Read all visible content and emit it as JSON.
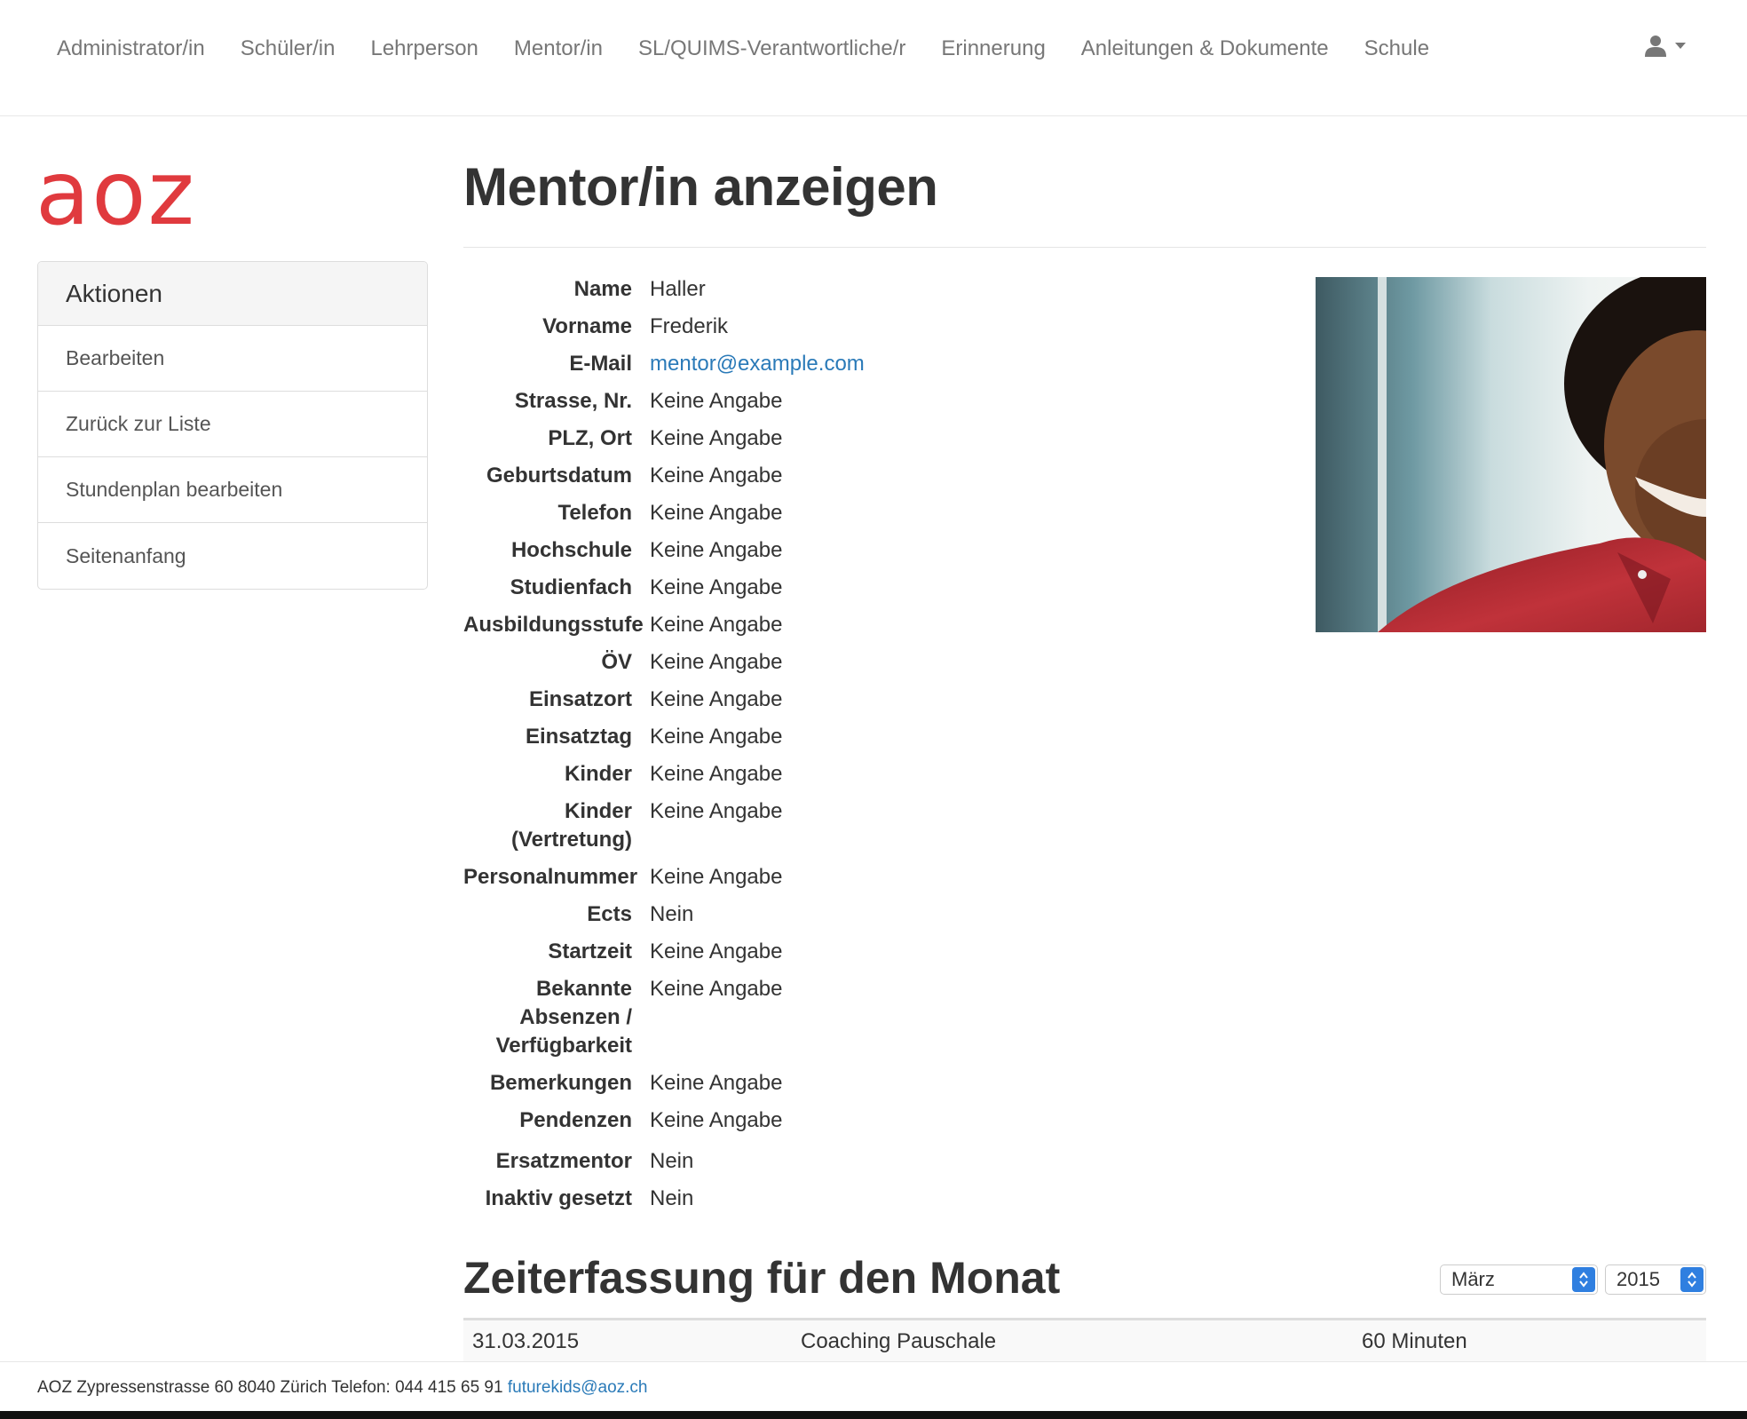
{
  "nav": {
    "items": [
      {
        "label": "Administrator/in"
      },
      {
        "label": "Schüler/in"
      },
      {
        "label": "Lehrperson"
      },
      {
        "label": "Mentor/in"
      },
      {
        "label": "SL/QUIMS-Verantwortliche/r"
      },
      {
        "label": "Erinnerung"
      },
      {
        "label": "Anleitungen & Dokumente"
      },
      {
        "label": "Schule"
      }
    ],
    "user_icon": "user-icon",
    "caret_icon": "caret-down-icon"
  },
  "logo": {
    "text": "aoz",
    "color": "#e03a3e"
  },
  "sidebar": {
    "heading": "Aktionen",
    "items": [
      {
        "label": "Bearbeiten"
      },
      {
        "label": "Zurück zur Liste"
      },
      {
        "label": "Stundenplan bearbeiten"
      },
      {
        "label": "Seitenanfang"
      }
    ]
  },
  "page": {
    "title": "Mentor/in anzeigen"
  },
  "details": {
    "name": {
      "label": "Name",
      "value": "Haller"
    },
    "vorname": {
      "label": "Vorname",
      "value": "Frederik"
    },
    "email": {
      "label": "E-Mail",
      "value": "mentor@example.com"
    },
    "strasse": {
      "label": "Strasse, Nr.",
      "value": "Keine Angabe"
    },
    "plz": {
      "label": "PLZ, Ort",
      "value": "Keine Angabe"
    },
    "geburtsdatum": {
      "label": "Geburtsdatum",
      "value": "Keine Angabe"
    },
    "telefon": {
      "label": "Telefon",
      "value": "Keine Angabe"
    },
    "hochschule": {
      "label": "Hochschule",
      "value": "Keine Angabe"
    },
    "studienfach": {
      "label": "Studienfach",
      "value": "Keine Angabe"
    },
    "ausbildungsstufe": {
      "label": "Ausbildungsstufe",
      "value": "Keine Angabe"
    },
    "oev": {
      "label": "ÖV",
      "value": "Keine Angabe"
    },
    "einsatzort": {
      "label": "Einsatzort",
      "value": "Keine Angabe"
    },
    "einsatztag": {
      "label": "Einsatztag",
      "value": "Keine Angabe"
    },
    "kinder": {
      "label": "Kinder",
      "value": "Keine Angabe"
    },
    "kinder_vertretung": {
      "label": "Kinder (Vertretung)",
      "value": "Keine Angabe"
    },
    "personalnummer": {
      "label": "Personalnummer",
      "value": "Keine Angabe"
    },
    "ects": {
      "label": "Ects",
      "value": "Nein"
    },
    "startzeit": {
      "label": "Startzeit",
      "value": "Keine Angabe"
    },
    "absenzen": {
      "label": "Bekannte Absenzen / Verfügbarkeit",
      "value": "Keine Angabe"
    },
    "bemerkungen": {
      "label": "Bemerkungen",
      "value": "Keine Angabe"
    },
    "pendenzen": {
      "label": "Pendenzen",
      "value": "Keine Angabe"
    },
    "ersatzmentor": {
      "label": "Ersatzmentor",
      "value": "Nein"
    },
    "inaktiv": {
      "label": "Inaktiv gesetzt",
      "value": "Nein"
    }
  },
  "zeiterfassung": {
    "title": "Zeiterfassung für den Monat",
    "month": "März",
    "year": "2015",
    "rows": [
      {
        "date": "31.03.2015",
        "type": "Coaching Pauschale",
        "duration": "60 Minuten"
      }
    ]
  },
  "footer": {
    "address": "AOZ Zypressenstrasse 60 8040 Zürich Telefon: 044 415 65 91",
    "email": "futurekids@aoz.ch"
  },
  "colors": {
    "link": "#2a7ab8",
    "brand": "#e03a3e",
    "select_accent": "#2f7fe0"
  }
}
